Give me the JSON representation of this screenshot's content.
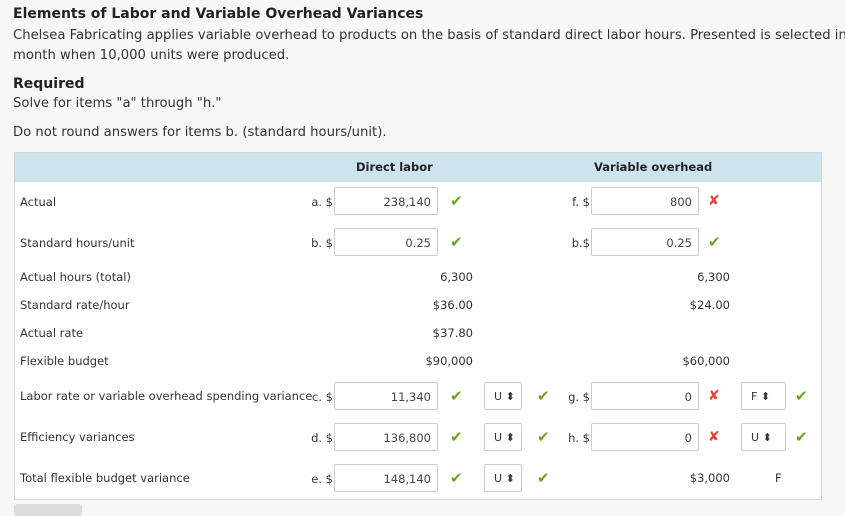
{
  "title": "Elements of Labor and Variable Overhead Variances",
  "intro_line1": "Chelsea Fabricating applies variable overhead to products on the basis of standard direct labor hours. Presented is selected info",
  "intro_line2": "month when 10,000 units were produced.",
  "required_heading": "Required",
  "instruction1": "Solve for items \"a\" through \"h.\"",
  "instruction2": "Do not round answers for items b. (standard hours/unit).",
  "columns": {
    "direct_labor": "Direct labor",
    "variable_overhead": "Variable overhead"
  },
  "rows": {
    "actual": {
      "label": "Actual",
      "dl_prefix": "a. $",
      "dl_value": "238,140",
      "dl_status": "correct",
      "vo_prefix": "f. $",
      "vo_value": "800",
      "vo_status": "incorrect"
    },
    "std_hours": {
      "label": "Standard hours/unit",
      "dl_prefix": "b. $",
      "dl_value": "0.25",
      "dl_status": "correct",
      "vo_prefix": "b.$",
      "vo_value": "0.25",
      "vo_status": "correct"
    },
    "actual_hours": {
      "label": "Actual hours (total)",
      "dl": "6,300",
      "vo": "6,300"
    },
    "std_rate": {
      "label": "Standard rate/hour",
      "dl": "$36.00",
      "vo": "$24.00"
    },
    "actual_rate": {
      "label": "Actual rate",
      "dl": "$37.80"
    },
    "flex_budget": {
      "label": "Flexible budget",
      "dl": "$90,000",
      "vo": "$60,000"
    },
    "rate_var": {
      "label": "Labor rate or variable overhead spending variance",
      "dl_prefix": "c. $",
      "dl_value": "11,340",
      "dl_fu": "U",
      "vo_prefix": "g. $",
      "vo_value": "0",
      "vo_fu": "F"
    },
    "eff_var": {
      "label": "Efficiency variances",
      "dl_prefix": "d. $",
      "dl_value": "136,800",
      "dl_fu": "U",
      "vo_prefix": "h. $",
      "vo_value": "0",
      "vo_fu": "U"
    },
    "total_var": {
      "label": "Total flexible budget variance",
      "dl_prefix": "e. $",
      "dl_value": "148,140",
      "dl_fu": "U",
      "vo": "$3,000",
      "vo_fu": "F"
    }
  },
  "icons": {
    "check": "✔",
    "cross": "✘",
    "updown": "⬍"
  },
  "colors": {
    "header": "#cde3ee",
    "correct": "#6aa61c",
    "incorrect": "#e8423a"
  }
}
